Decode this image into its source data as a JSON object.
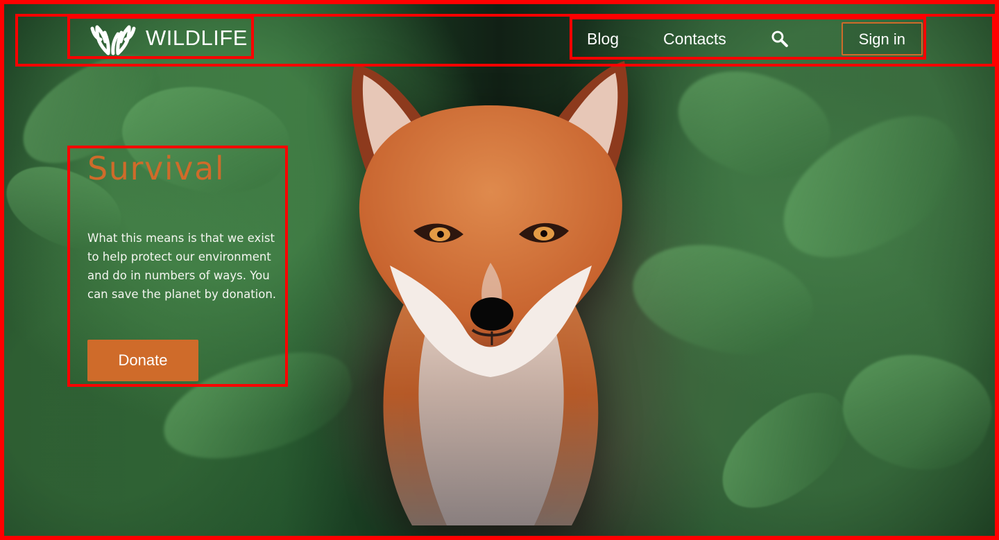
{
  "page": {
    "background_image": "fox-among-green-leaves",
    "frame_color": "#ff0000"
  },
  "logo": {
    "text": "WILDLIFE",
    "icon": "antlers-icon"
  },
  "nav": {
    "items": [
      {
        "label": "Blog"
      },
      {
        "label": "Contacts"
      }
    ],
    "search_icon": "search-icon",
    "sign_in_label": "Sign in"
  },
  "hero": {
    "title": "Survival",
    "description": "What this means is that we exist to help protect our environment and do in numbers of ways. You can save the planet by donation.",
    "donate_label": "Donate"
  },
  "colors": {
    "accent": "#cf6b2a",
    "text": "#ffffff"
  }
}
